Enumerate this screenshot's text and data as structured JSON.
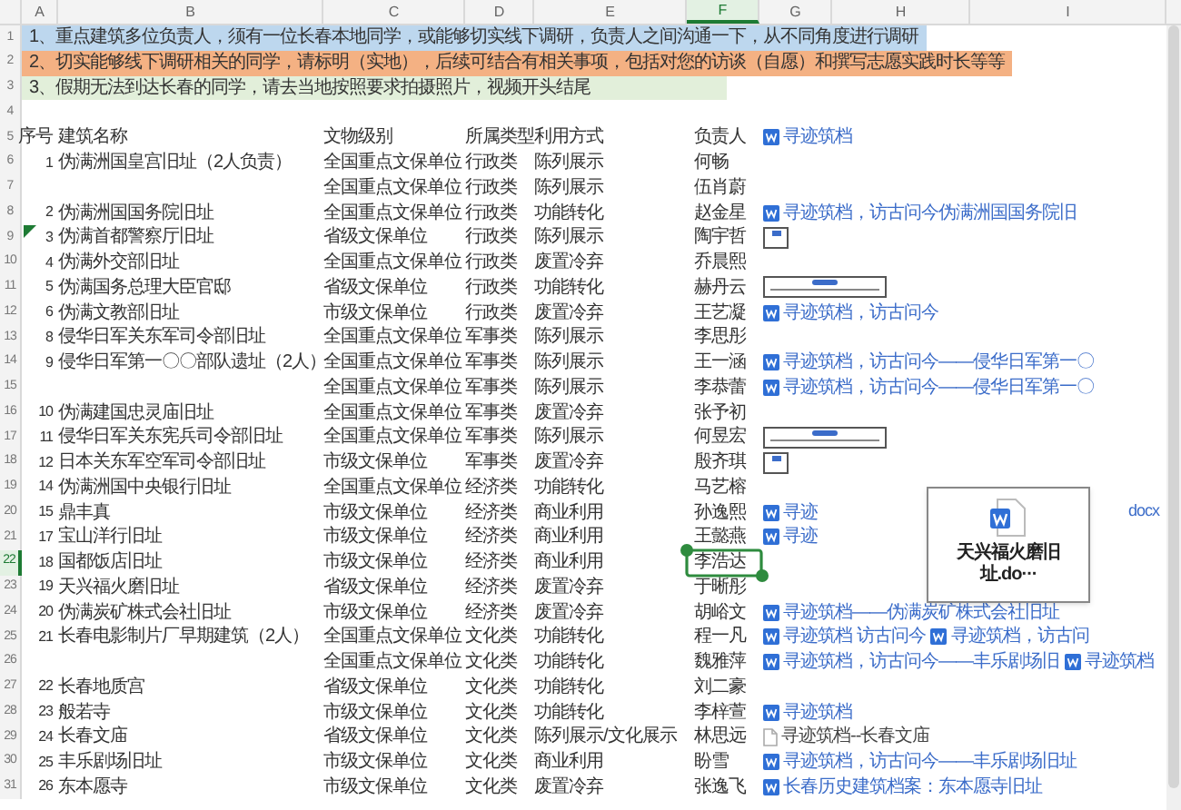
{
  "column_headers": [
    {
      "label": "A",
      "selected": false
    },
    {
      "label": "B",
      "selected": false
    },
    {
      "label": "C",
      "selected": false
    },
    {
      "label": "D",
      "selected": false
    },
    {
      "label": "E",
      "selected": false
    },
    {
      "label": "F",
      "selected": true
    },
    {
      "label": "G",
      "selected": false
    },
    {
      "label": "H",
      "selected": false
    },
    {
      "label": "I",
      "selected": false
    }
  ],
  "rows": [
    {
      "number": "1",
      "kind": "note",
      "selected": false,
      "flagged": false,
      "color": "#bdd7ee",
      "text": "1、重点建筑多位负责人，须有一位长春本地同学，或能够切实线下调研，负责人之间沟通一下，从不同角度进行调研"
    },
    {
      "number": "2",
      "kind": "note",
      "selected": false,
      "flagged": false,
      "color": "#f4b183",
      "text": "2、切实能够线下调研相关的同学，请标明（实地），后续可结合有相关事项，包括对您的访谈（自愿）和撰写志愿实践时长等等"
    },
    {
      "number": "3",
      "kind": "note",
      "selected": false,
      "flagged": false,
      "color": "#e2efda",
      "text": "3、假期无法到达长春的同学，请去当地按照要求拍摄照片，视频开头结尾"
    },
    {
      "number": "4",
      "kind": "blank",
      "selected": false,
      "flagged": false
    },
    {
      "number": "5",
      "kind": "header",
      "selected": false,
      "flagged": false,
      "cells": {
        "seq": "序号",
        "name": "建筑名称",
        "level": "文物级别",
        "type": "所属类型",
        "use": "利用方式",
        "owner": "负责人"
      },
      "links": [
        {
          "kind": "word",
          "text": "寻迹筑档"
        }
      ]
    },
    {
      "number": "6",
      "kind": "data",
      "selected": false,
      "flagged": false,
      "cells": {
        "seq": "1",
        "name": "伪满洲国皇宫旧址（2人负责）",
        "level": "全国重点文保单位",
        "type": "行政类",
        "use": "陈列展示",
        "owner": "何畅"
      }
    },
    {
      "number": "7",
      "kind": "data",
      "selected": false,
      "flagged": false,
      "cells": {
        "level": "全国重点文保单位",
        "type": "行政类",
        "use": "陈列展示",
        "owner": "伍肖蔚"
      }
    },
    {
      "number": "8",
      "kind": "data",
      "selected": false,
      "flagged": false,
      "cells": {
        "seq": "2",
        "name": "伪满洲国国务院旧址",
        "level": "全国重点文保单位",
        "type": "行政类",
        "use": "功能转化",
        "owner": "赵金星"
      },
      "links": [
        {
          "kind": "word",
          "text": "寻迹筑档，访古问今伪满洲国国务院旧"
        }
      ]
    },
    {
      "number": "9",
      "kind": "data",
      "selected": false,
      "flagged": true,
      "cells": {
        "seq": "3",
        "name": "伪满首都警察厅旧址",
        "level": "省级文保单位",
        "type": "行政类",
        "use": "陈列展示",
        "owner": "陶宇哲"
      },
      "links": [
        {
          "kind": "image-small"
        }
      ]
    },
    {
      "number": "10",
      "kind": "data",
      "selected": false,
      "flagged": false,
      "cells": {
        "seq": "4",
        "name": "伪满外交部旧址",
        "level": "全国重点文保单位",
        "type": "行政类",
        "use": "废置冷弃",
        "owner": "乔晨熙"
      }
    },
    {
      "number": "11",
      "kind": "data",
      "selected": false,
      "flagged": false,
      "cells": {
        "seq": "5",
        "name": "伪满国务总理大臣官邸",
        "level": "省级文保单位",
        "type": "行政类",
        "use": "功能转化",
        "owner": "赫丹云"
      },
      "links": [
        {
          "kind": "image-wide"
        }
      ]
    },
    {
      "number": "12",
      "kind": "data",
      "selected": false,
      "flagged": false,
      "cells": {
        "seq": "6",
        "name": "伪满文教部旧址",
        "level": "市级文保单位",
        "type": "行政类",
        "use": "废置冷弃",
        "owner": "王艺凝"
      },
      "links": [
        {
          "kind": "word",
          "text": "寻迹筑档，访古问今"
        }
      ]
    },
    {
      "number": "13",
      "kind": "data",
      "selected": false,
      "flagged": false,
      "cells": {
        "seq": "8",
        "name": "侵华日军关东军司令部旧址",
        "level": "全国重点文保单位",
        "type": "军事类",
        "use": "陈列展示",
        "owner": "李思彤"
      }
    },
    {
      "number": "14",
      "kind": "data",
      "selected": false,
      "flagged": false,
      "cells": {
        "seq": "9",
        "name": "侵华日军第一〇〇部队遗址（2人）",
        "level": "全国重点文保单位",
        "type": "军事类",
        "use": "陈列展示",
        "owner": "王一涵"
      },
      "links": [
        {
          "kind": "word",
          "text": "寻迹筑档，访古问今——侵华日军第一〇"
        }
      ]
    },
    {
      "number": "15",
      "kind": "data",
      "selected": false,
      "flagged": false,
      "cells": {
        "level": "全国重点文保单位",
        "type": "军事类",
        "use": "陈列展示",
        "owner": "李恭蕾"
      },
      "links": [
        {
          "kind": "word",
          "text": "寻迹筑档，访古问今——侵华日军第一〇"
        }
      ]
    },
    {
      "number": "16",
      "kind": "data",
      "selected": false,
      "flagged": false,
      "cells": {
        "seq": "10",
        "name": "伪满建国忠灵庙旧址",
        "level": "全国重点文保单位",
        "type": "军事类",
        "use": "废置冷弃",
        "owner": "张予初"
      }
    },
    {
      "number": "17",
      "kind": "data",
      "selected": false,
      "flagged": false,
      "cells": {
        "seq": "11",
        "name": "侵华日军关东宪兵司令部旧址",
        "level": "全国重点文保单位",
        "type": "军事类",
        "use": "陈列展示",
        "owner": "何昱宏"
      },
      "links": [
        {
          "kind": "image-wide"
        }
      ]
    },
    {
      "number": "18",
      "kind": "data",
      "selected": false,
      "flagged": false,
      "cells": {
        "seq": "12",
        "name": "日本关东军空军司令部旧址",
        "level": "市级文保单位",
        "type": "军事类",
        "use": "废置冷弃",
        "owner": "殷齐琪"
      },
      "links": [
        {
          "kind": "image-small"
        }
      ]
    },
    {
      "number": "19",
      "kind": "data",
      "selected": false,
      "flagged": false,
      "cells": {
        "seq": "14",
        "name": "伪满洲国中央银行旧址",
        "level": "全国重点文保单位",
        "type": "经济类",
        "use": "功能转化",
        "owner": "马艺榕"
      }
    },
    {
      "number": "20",
      "kind": "data",
      "selected": false,
      "flagged": false,
      "cells": {
        "seq": "15",
        "name": "鼎丰真",
        "level": "市级文保单位",
        "type": "经济类",
        "use": "商业利用",
        "owner": "孙逸熙"
      },
      "links": [
        {
          "kind": "word",
          "text": "寻迹"
        },
        {
          "kind": "tail",
          "text": "docx"
        }
      ]
    },
    {
      "number": "21",
      "kind": "data",
      "selected": false,
      "flagged": false,
      "cells": {
        "seq": "17",
        "name": "宝山洋行旧址",
        "level": "市级文保单位",
        "type": "经济类",
        "use": "商业利用",
        "owner": "王懿燕"
      },
      "links": [
        {
          "kind": "word",
          "text": "寻迹"
        }
      ]
    },
    {
      "number": "22",
      "kind": "data",
      "selected": true,
      "flagged": false,
      "cells": {
        "seq": "18",
        "name": "国都饭店旧址",
        "level": "市级文保单位",
        "type": "经济类",
        "use": "商业利用",
        "owner": "李浩达"
      }
    },
    {
      "number": "23",
      "kind": "data",
      "selected": false,
      "flagged": false,
      "cells": {
        "seq": "19",
        "name": "天兴福火磨旧址",
        "level": "省级文保单位",
        "type": "经济类",
        "use": "废置冷弃",
        "owner": "于晰彤"
      }
    },
    {
      "number": "24",
      "kind": "data",
      "selected": false,
      "flagged": false,
      "cells": {
        "seq": "20",
        "name": "伪满炭矿株式会社旧址",
        "level": "市级文保单位",
        "type": "经济类",
        "use": "废置冷弃",
        "owner": "胡峪文"
      },
      "links": [
        {
          "kind": "word",
          "text": "寻迹筑档——伪满炭矿株式会社旧址"
        }
      ]
    },
    {
      "number": "25",
      "kind": "data",
      "selected": false,
      "flagged": false,
      "cells": {
        "seq": "21",
        "name": "长春电影制片厂早期建筑（2人）",
        "level": "全国重点文保单位",
        "type": "文化类",
        "use": "功能转化",
        "owner": "程一凡"
      },
      "links": [
        {
          "kind": "word",
          "text": "寻迹筑档 访古问今"
        },
        {
          "kind": "word",
          "text": "寻迹筑档，访古问"
        }
      ]
    },
    {
      "number": "26",
      "kind": "data",
      "selected": false,
      "flagged": false,
      "cells": {
        "level": "全国重点文保单位",
        "type": "文化类",
        "use": "功能转化",
        "owner": "魏雅萍"
      },
      "links": [
        {
          "kind": "word",
          "text": "寻迹筑档，访古问今——丰乐剧场旧"
        },
        {
          "kind": "word",
          "text": "寻迹筑档"
        }
      ]
    },
    {
      "number": "27",
      "kind": "data",
      "selected": false,
      "flagged": false,
      "cells": {
        "seq": "22",
        "name": "长春地质宫",
        "level": "省级文保单位",
        "type": "文化类",
        "use": "功能转化",
        "owner": "刘二豪"
      }
    },
    {
      "number": "28",
      "kind": "data",
      "selected": false,
      "flagged": false,
      "cells": {
        "seq": "23",
        "name": "般若寺",
        "level": "市级文保单位",
        "type": "文化类",
        "use": "功能转化",
        "owner": "李梓萱"
      },
      "links": [
        {
          "kind": "word",
          "text": "寻迹筑档"
        }
      ]
    },
    {
      "number": "29",
      "kind": "data",
      "selected": false,
      "flagged": false,
      "cells": {
        "seq": "24",
        "name": "长春文庙",
        "level": "省级文保单位",
        "type": "文化类",
        "use": "陈列展示/文化展示",
        "owner": "林思远"
      },
      "links": [
        {
          "kind": "file",
          "text": "寻迹筑档--长春文庙"
        }
      ]
    },
    {
      "number": "30",
      "kind": "data",
      "selected": false,
      "flagged": false,
      "cells": {
        "seq": "25",
        "name": "丰乐剧场旧址",
        "level": "市级文保单位",
        "type": "文化类",
        "use": "商业利用",
        "owner": "盼雪"
      },
      "links": [
        {
          "kind": "word",
          "text": "寻迹筑档，访古问今——丰乐剧场旧址"
        }
      ]
    },
    {
      "number": "31",
      "kind": "data",
      "selected": false,
      "flagged": false,
      "cells": {
        "seq": "26",
        "name": "东本愿寺",
        "level": "市级文保单位",
        "type": "文化类",
        "use": "废置冷弃",
        "owner": "张逸飞"
      },
      "links": [
        {
          "kind": "word",
          "text": "长春历史建筑档案：东本愿寺旧址"
        }
      ]
    }
  ],
  "file_card": {
    "name": "天兴福火磨旧址.do···"
  }
}
